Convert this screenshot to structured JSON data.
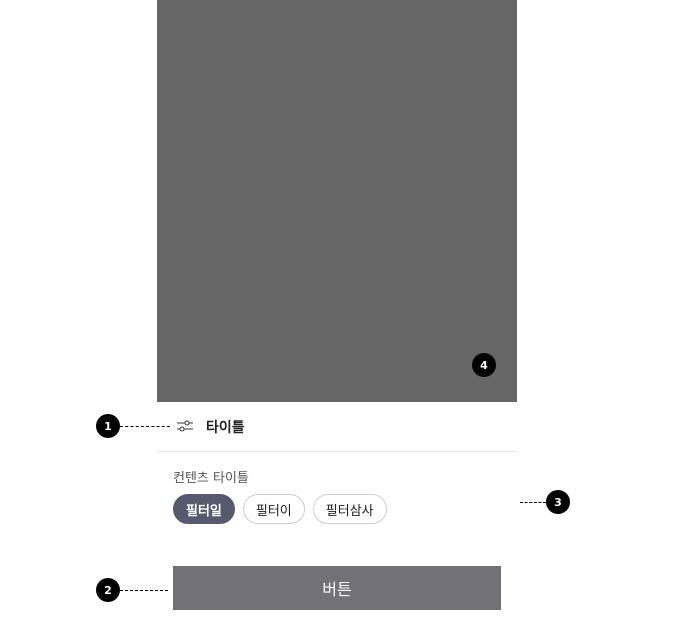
{
  "markers": {
    "m1": "1",
    "m2": "2",
    "m3": "3",
    "m4": "4"
  },
  "sheet": {
    "title": "타이틀",
    "content_title": "컨텐츠 타이틀",
    "chips": [
      {
        "label": "필터일",
        "active": true
      },
      {
        "label": "필터이",
        "active": false
      },
      {
        "label": "필터삼사",
        "active": false
      }
    ],
    "button_label": "버튼"
  },
  "colors": {
    "overlay": "#666666",
    "chip_active": "#555a6e",
    "button": "#727178"
  },
  "icons": {
    "header_icon": "filter-sliders-icon"
  }
}
